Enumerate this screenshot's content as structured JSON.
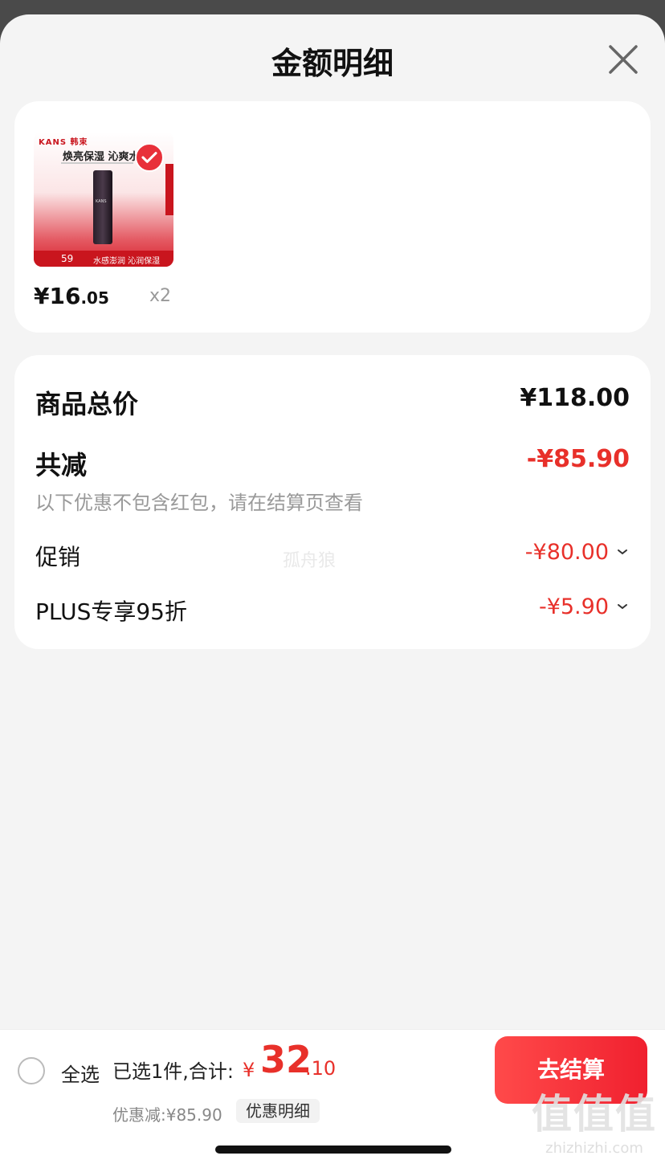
{
  "header": {
    "title": "金额明细"
  },
  "product": {
    "image": {
      "brand": "KANS 韩束",
      "headline": "焕亮保湿 沁爽水",
      "bottle_label": "KANS",
      "price": "59",
      "slogan": "水感澎润 沁润保湿"
    },
    "unit_price_int": "¥16",
    "unit_price_dec": ".05",
    "quantity": "x2"
  },
  "summary": {
    "total_label": "商品总价",
    "total_value": "¥118.00",
    "reduction_label": "共减",
    "reduction_value": "-¥85.90",
    "note": "以下优惠不包含红包，请在结算页查看",
    "promo_label": "促销",
    "promo_value": "-¥80.00",
    "plus_label": "PLUS专享95折",
    "plus_value": "-¥5.90"
  },
  "watermark": "孤舟狼",
  "footer": {
    "select_all": "全选",
    "selected_text": "已选1件,合计:",
    "total_currency": "¥",
    "total_int": "32",
    "total_dec": ".10",
    "discount_text": "优惠减:¥85.90",
    "detail_label": "优惠明细",
    "checkout_label": "去结算"
  },
  "corner_watermark": {
    "logo": "值值值",
    "site": "zhizhizhi.com"
  },
  "colors": {
    "accent": "#e8302a",
    "sheet_bg": "#f4f4f4",
    "card_bg": "#ffffff"
  }
}
